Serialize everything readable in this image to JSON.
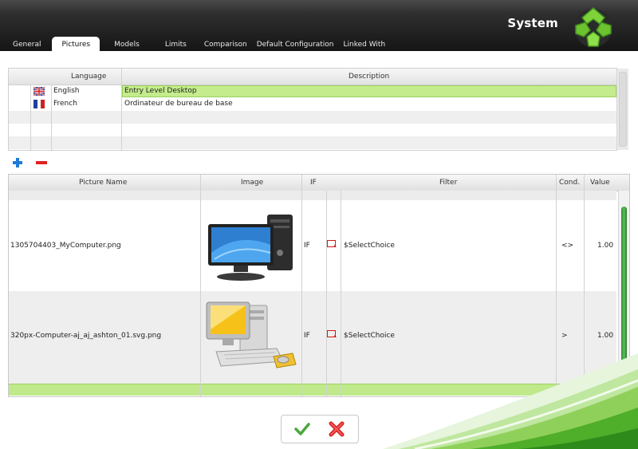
{
  "header": {
    "title": "System",
    "tabs": [
      {
        "label": "General"
      },
      {
        "label": "Pictures"
      },
      {
        "label": "Models"
      },
      {
        "label": "Limits"
      },
      {
        "label": "Comparison"
      },
      {
        "label": "Default Configuration"
      },
      {
        "label": "Linked With"
      }
    ],
    "active_tab": "Pictures"
  },
  "language_table": {
    "columns": {
      "language": "Language",
      "description": "Description"
    },
    "rows": [
      {
        "language": "English",
        "flag": "uk-flag-icon",
        "description": "Entry Level Desktop",
        "selected": true
      },
      {
        "language": "French",
        "flag": "france-flag-icon",
        "description": "Ordinateur de bureau de base",
        "selected": false
      }
    ]
  },
  "toolbar": {
    "add_icon": "plus-icon",
    "remove_icon": "minus-icon"
  },
  "pictures_table": {
    "columns": {
      "picture_name": "Picture Name",
      "image": "Image",
      "if": "IF",
      "filter": "Filter",
      "cond": "Cond.",
      "value": "Value"
    },
    "rows": [
      {
        "picture_name": "1305704403_MyComputer.png",
        "image": "desktop-computer-image",
        "if": "IF",
        "filter": "$SelectChoice",
        "cond": "<>",
        "value": "1.00"
      },
      {
        "picture_name": "320px-Computer-aj_aj_ashton_01.svg.png",
        "image": "retro-computer-image",
        "if": "IF",
        "filter": "$SelectChoice",
        "cond": ">",
        "value": "1.00"
      }
    ]
  },
  "actions": {
    "ok_icon": "checkmark-icon",
    "cancel_icon": "cross-icon"
  },
  "colors": {
    "selection": "#c4ec8c",
    "accent_green": "#3ea63f",
    "header": "#222222",
    "remove_red": "#e02020",
    "add_blue": "#1e7ad6"
  }
}
